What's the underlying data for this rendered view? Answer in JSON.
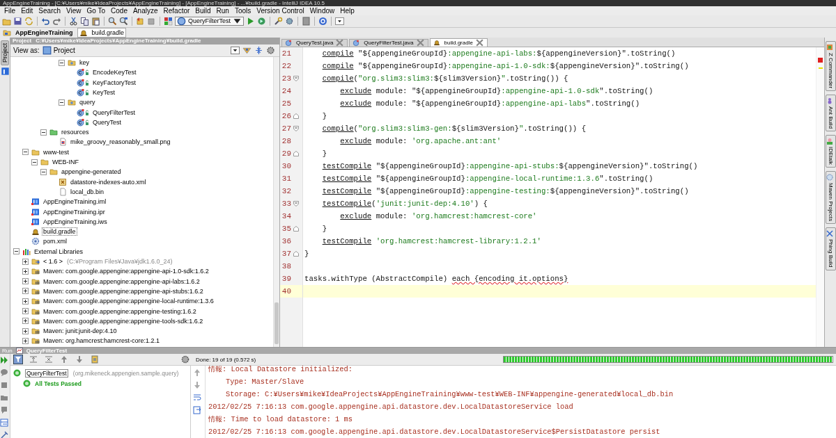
{
  "window": {
    "title": "AppEngineTraining - [C:¥Users¥mike¥IdeaProjects¥AppEngineTraining] - [AppEngineTraining] - ...¥build.gradle - IntelliJ IDEA 10.5"
  },
  "menu": [
    "File",
    "Edit",
    "Search",
    "View",
    "Go To",
    "Code",
    "Analyze",
    "Refactor",
    "Build",
    "Run",
    "Tools",
    "Version Control",
    "Window",
    "Help"
  ],
  "toolbar": {
    "run_config": "QueryFilterTest"
  },
  "breadcrumbs": [
    {
      "label": "AppEngineTraining",
      "kind": "project"
    },
    {
      "label": "build.gradle",
      "kind": "gradle"
    }
  ],
  "left_stripe": [
    {
      "label": "Project",
      "selected": true
    }
  ],
  "project_panel": {
    "title": "Project",
    "path": "C:¥Users¥mike¥IdeaProjects¥AppEngineTraining¥build.gradle",
    "view_as_label": "View as:",
    "view": "Project",
    "tree": [
      {
        "children": [
          {
            "children": [
              {
                "children": [
                  {
                    "children": [
                      {
                        "children": [
                          {
                            "label": "key",
                            "kind": "package",
                            "expanded": true,
                            "selected": false,
                            "children": [
                              {
                                "label": "EncodeKeyTest",
                                "kind": "test-class",
                                "selected": false
                              },
                              {
                                "label": "KeyFactoryTest",
                                "kind": "test-class",
                                "selected": false
                              },
                              {
                                "label": "KeyTest",
                                "kind": "test-class",
                                "selected": false
                              }
                            ]
                          },
                          {
                            "label": "query",
                            "kind": "package",
                            "expanded": true,
                            "selected": false,
                            "children": [
                              {
                                "label": "QueryFilterTest",
                                "kind": "test-class",
                                "selected": false
                              },
                              {
                                "label": "QueryTest",
                                "kind": "test-class",
                                "selected": false
                              }
                            ]
                          }
                        ]
                      }
                    ]
                  },
                  {
                    "label": "resources",
                    "kind": "resource-folder",
                    "expanded": true,
                    "selected": false,
                    "children": [
                      {
                        "label": "mike_groovy_reasonably_small.png",
                        "kind": "image",
                        "selected": false
                      }
                    ]
                  }
                ]
              }
            ]
          },
          {
            "label": "www-test",
            "kind": "folder",
            "expanded": true,
            "selected": false,
            "children": [
              {
                "label": "WEB-INF",
                "kind": "folder",
                "expanded": true,
                "selected": false,
                "children": [
                  {
                    "label": "appengine-generated",
                    "kind": "folder",
                    "expanded": true,
                    "selected": false,
                    "children": [
                      {
                        "label": "datastore-indexes-auto.xml",
                        "kind": "xml",
                        "selected": false
                      },
                      {
                        "label": "local_db.bin",
                        "kind": "file",
                        "selected": false
                      }
                    ]
                  }
                ]
              }
            ]
          },
          {
            "label": "AppEngineTraining.iml",
            "kind": "module",
            "selected": false
          },
          {
            "label": "AppEngineTraining.ipr",
            "kind": "module",
            "selected": false
          },
          {
            "label": "AppEngineTraining.iws",
            "kind": "module",
            "selected": false
          },
          {
            "label": "build.gradle",
            "kind": "gradle",
            "selected": true
          },
          {
            "label": "pom.xml",
            "kind": "maven",
            "selected": false
          }
        ]
      },
      {
        "label": "External Libraries",
        "kind": "libraries",
        "expanded": true,
        "selected": false,
        "children": [
          {
            "label": "< 1.6 >",
            "detail": "(C:¥Program Files¥Java¥jdk1.6.0_24)",
            "kind": "jdk",
            "expanded": false,
            "selected": false
          },
          {
            "label": "Maven: com.google.appengine:appengine-api-1.0-sdk:1.6.2",
            "kind": "library",
            "expanded": false,
            "selected": false
          },
          {
            "label": "Maven: com.google.appengine:appengine-api-labs:1.6.2",
            "kind": "library",
            "expanded": false,
            "selected": false
          },
          {
            "label": "Maven: com.google.appengine:appengine-api-stubs:1.6.2",
            "kind": "library",
            "expanded": false,
            "selected": false
          },
          {
            "label": "Maven: com.google.appengine:appengine-local-runtime:1.3.6",
            "kind": "library",
            "expanded": false,
            "selected": false
          },
          {
            "label": "Maven: com.google.appengine:appengine-testing:1.6.2",
            "kind": "library",
            "expanded": false,
            "selected": false
          },
          {
            "label": "Maven: com.google.appengine:appengine-tools-sdk:1.6.2",
            "kind": "library",
            "expanded": false,
            "selected": false
          },
          {
            "label": "Maven: junit:junit-dep:4.10",
            "kind": "library",
            "expanded": false,
            "selected": false
          },
          {
            "label": "Maven: org.hamcrest:hamcrest-core:1.2.1",
            "kind": "library",
            "expanded": false,
            "selected": false
          }
        ]
      }
    ]
  },
  "editor": {
    "tabs": [
      {
        "label": "QueryTest.java",
        "kind": "java",
        "selected": false
      },
      {
        "label": "QueryFilterTest.java",
        "kind": "java",
        "selected": false
      },
      {
        "label": "build.gradle",
        "kind": "gradle",
        "selected": true
      }
    ],
    "lines": [
      {
        "number": "21",
        "current": false,
        "segments": [
          {
            "kind": "method",
            "text": "    compile"
          },
          {
            "kind": "plain",
            "text": " \"${appengineGroupId}"
          },
          {
            "kind": "string",
            "text": ":appengine-api-labs:"
          },
          {
            "kind": "plain",
            "text": "${appengineVersion}\".toString()"
          }
        ]
      },
      {
        "number": "22",
        "current": false,
        "segments": [
          {
            "kind": "method",
            "text": "    compile"
          },
          {
            "kind": "plain",
            "text": " \"${appengineGroupId}"
          },
          {
            "kind": "string",
            "text": ":appengine-api-1.0-sdk:"
          },
          {
            "kind": "plain",
            "text": "${appengineVersion}\".toString()"
          }
        ]
      },
      {
        "number": "23",
        "current": false,
        "fold_start": true,
        "segments": [
          {
            "kind": "method",
            "text": "    compile"
          },
          {
            "kind": "plain",
            "text": "("
          },
          {
            "kind": "string",
            "text": "\"org.slim3:slim3:"
          },
          {
            "kind": "plain",
            "text": "${slim3Version}"
          },
          {
            "kind": "string",
            "text": "\""
          },
          {
            "kind": "plain",
            "text": ".toString()) {"
          }
        ]
      },
      {
        "number": "24",
        "current": false,
        "segments": [
          {
            "kind": "method",
            "text": "        exclude"
          },
          {
            "kind": "plain",
            "text": " module: \"${appengineGroupId}"
          },
          {
            "kind": "string",
            "text": ":appengine-api-1.0-sdk"
          },
          {
            "kind": "plain",
            "text": "\".toString()"
          }
        ]
      },
      {
        "number": "25",
        "current": false,
        "segments": [
          {
            "kind": "method",
            "text": "        exclude"
          },
          {
            "kind": "plain",
            "text": " module: \"${appengineGroupId}"
          },
          {
            "kind": "string",
            "text": ":appengine-api-labs"
          },
          {
            "kind": "plain",
            "text": "\".toString()"
          }
        ]
      },
      {
        "number": "26",
        "current": false,
        "fold_end": true,
        "segments": [
          {
            "kind": "plain",
            "text": "    }"
          }
        ]
      },
      {
        "number": "27",
        "current": false,
        "fold_start": true,
        "segments": [
          {
            "kind": "method",
            "text": "    compile"
          },
          {
            "kind": "plain",
            "text": "("
          },
          {
            "kind": "string",
            "text": "\"org.slim3:slim3-gen:"
          },
          {
            "kind": "plain",
            "text": "${slim3Version}"
          },
          {
            "kind": "string",
            "text": "\""
          },
          {
            "kind": "plain",
            "text": ".toString()) {"
          }
        ]
      },
      {
        "number": "28",
        "current": false,
        "segments": [
          {
            "kind": "method",
            "text": "        exclude"
          },
          {
            "kind": "plain",
            "text": " module: "
          },
          {
            "kind": "string",
            "text": "'org.apache.ant:ant'"
          }
        ]
      },
      {
        "number": "29",
        "current": false,
        "fold_end": true,
        "segments": [
          {
            "kind": "plain",
            "text": "    }"
          }
        ]
      },
      {
        "number": "30",
        "current": false,
        "segments": [
          {
            "kind": "method",
            "text": "    testCompile"
          },
          {
            "kind": "plain",
            "text": " \"${appengineGroupId}"
          },
          {
            "kind": "string",
            "text": ":appengine-api-stubs:"
          },
          {
            "kind": "plain",
            "text": "${appengineVersion}\".toString()"
          }
        ]
      },
      {
        "number": "31",
        "current": false,
        "segments": [
          {
            "kind": "method",
            "text": "    testCompile"
          },
          {
            "kind": "plain",
            "text": " \"${appengineGroupId}"
          },
          {
            "kind": "string",
            "text": ":appengine-local-runtime:1.3.6"
          },
          {
            "kind": "plain",
            "text": "\".toString()"
          }
        ]
      },
      {
        "number": "32",
        "current": false,
        "segments": [
          {
            "kind": "method",
            "text": "    testCompile"
          },
          {
            "kind": "plain",
            "text": " \"${appengineGroupId}"
          },
          {
            "kind": "string",
            "text": ":appengine-testing:"
          },
          {
            "kind": "plain",
            "text": "${appengineVersion}\".toString()"
          }
        ]
      },
      {
        "number": "33",
        "current": false,
        "fold_start": true,
        "segments": [
          {
            "kind": "method",
            "text": "    testCompile"
          },
          {
            "kind": "plain",
            "text": "("
          },
          {
            "kind": "string",
            "text": "'junit:junit-dep:4.10'"
          },
          {
            "kind": "plain",
            "text": ") {"
          }
        ]
      },
      {
        "number": "34",
        "current": false,
        "segments": [
          {
            "kind": "method",
            "text": "        exclude"
          },
          {
            "kind": "plain",
            "text": " module: "
          },
          {
            "kind": "string",
            "text": "'org.hamcrest:hamcrest-core'"
          }
        ]
      },
      {
        "number": "35",
        "current": false,
        "fold_end": true,
        "segments": [
          {
            "kind": "plain",
            "text": "    }"
          }
        ]
      },
      {
        "number": "36",
        "current": false,
        "segments": [
          {
            "kind": "method",
            "text": "    testCompile"
          },
          {
            "kind": "string",
            "text": " 'org.hamcrest:hamcrest-library:1.2.1'"
          }
        ]
      },
      {
        "number": "37",
        "current": false,
        "fold_end": true,
        "segments": [
          {
            "kind": "plain",
            "text": "}"
          }
        ]
      },
      {
        "number": "38",
        "current": false
      },
      {
        "number": "39",
        "current": false,
        "segments": [
          {
            "kind": "plain",
            "text": "tasks.withType (AbstractCompile) "
          },
          {
            "kind": "error",
            "text": "each {encoding it.options}"
          }
        ]
      },
      {
        "number": "40",
        "current": true
      }
    ],
    "markers": [
      {
        "kind": "error"
      },
      {
        "kind": "warning"
      }
    ]
  },
  "right_stripe": [
    {
      "label": "Z Commander",
      "kind": "commander"
    },
    {
      "label": "Ant Build",
      "kind": "ant"
    },
    {
      "label": "IDEtalk",
      "kind": "talk"
    },
    {
      "label": "Maven Projects",
      "kind": "maven"
    },
    {
      "label": "Phing Build",
      "kind": "phing"
    }
  ],
  "run_panel": {
    "title": "Run",
    "tab": "QueryFilterTest",
    "status": "Done: 19 of 19 (0.572 s)",
    "progress": {
      "level": 1
    },
    "tests": [
      {
        "label": "QueryFilterTest",
        "detail": "(org.mikeneck.appengien.sample.query)",
        "selected": true,
        "children": [
          {
            "label": "All Tests Passed",
            "selected": false
          }
        ]
      }
    ],
    "console": [
      "情報: Local Datastore initialized:",
      "    Type: Master/Slave",
      "    Storage: C:¥Users¥mike¥IdeaProjects¥AppEngineTraining¥www-test¥WEB-INF¥appengine-generated¥local_db.bin",
      "2012/02/25 7:16:13 com.google.appengine.api.datastore.dev.LocalDatastoreService load",
      "情報: Time to load datastore: 1 ms",
      "2012/02/25 7:16:13 com.google.appengine.api.datastore.dev.LocalDatastoreService$PersistDatastore persist"
    ]
  }
}
